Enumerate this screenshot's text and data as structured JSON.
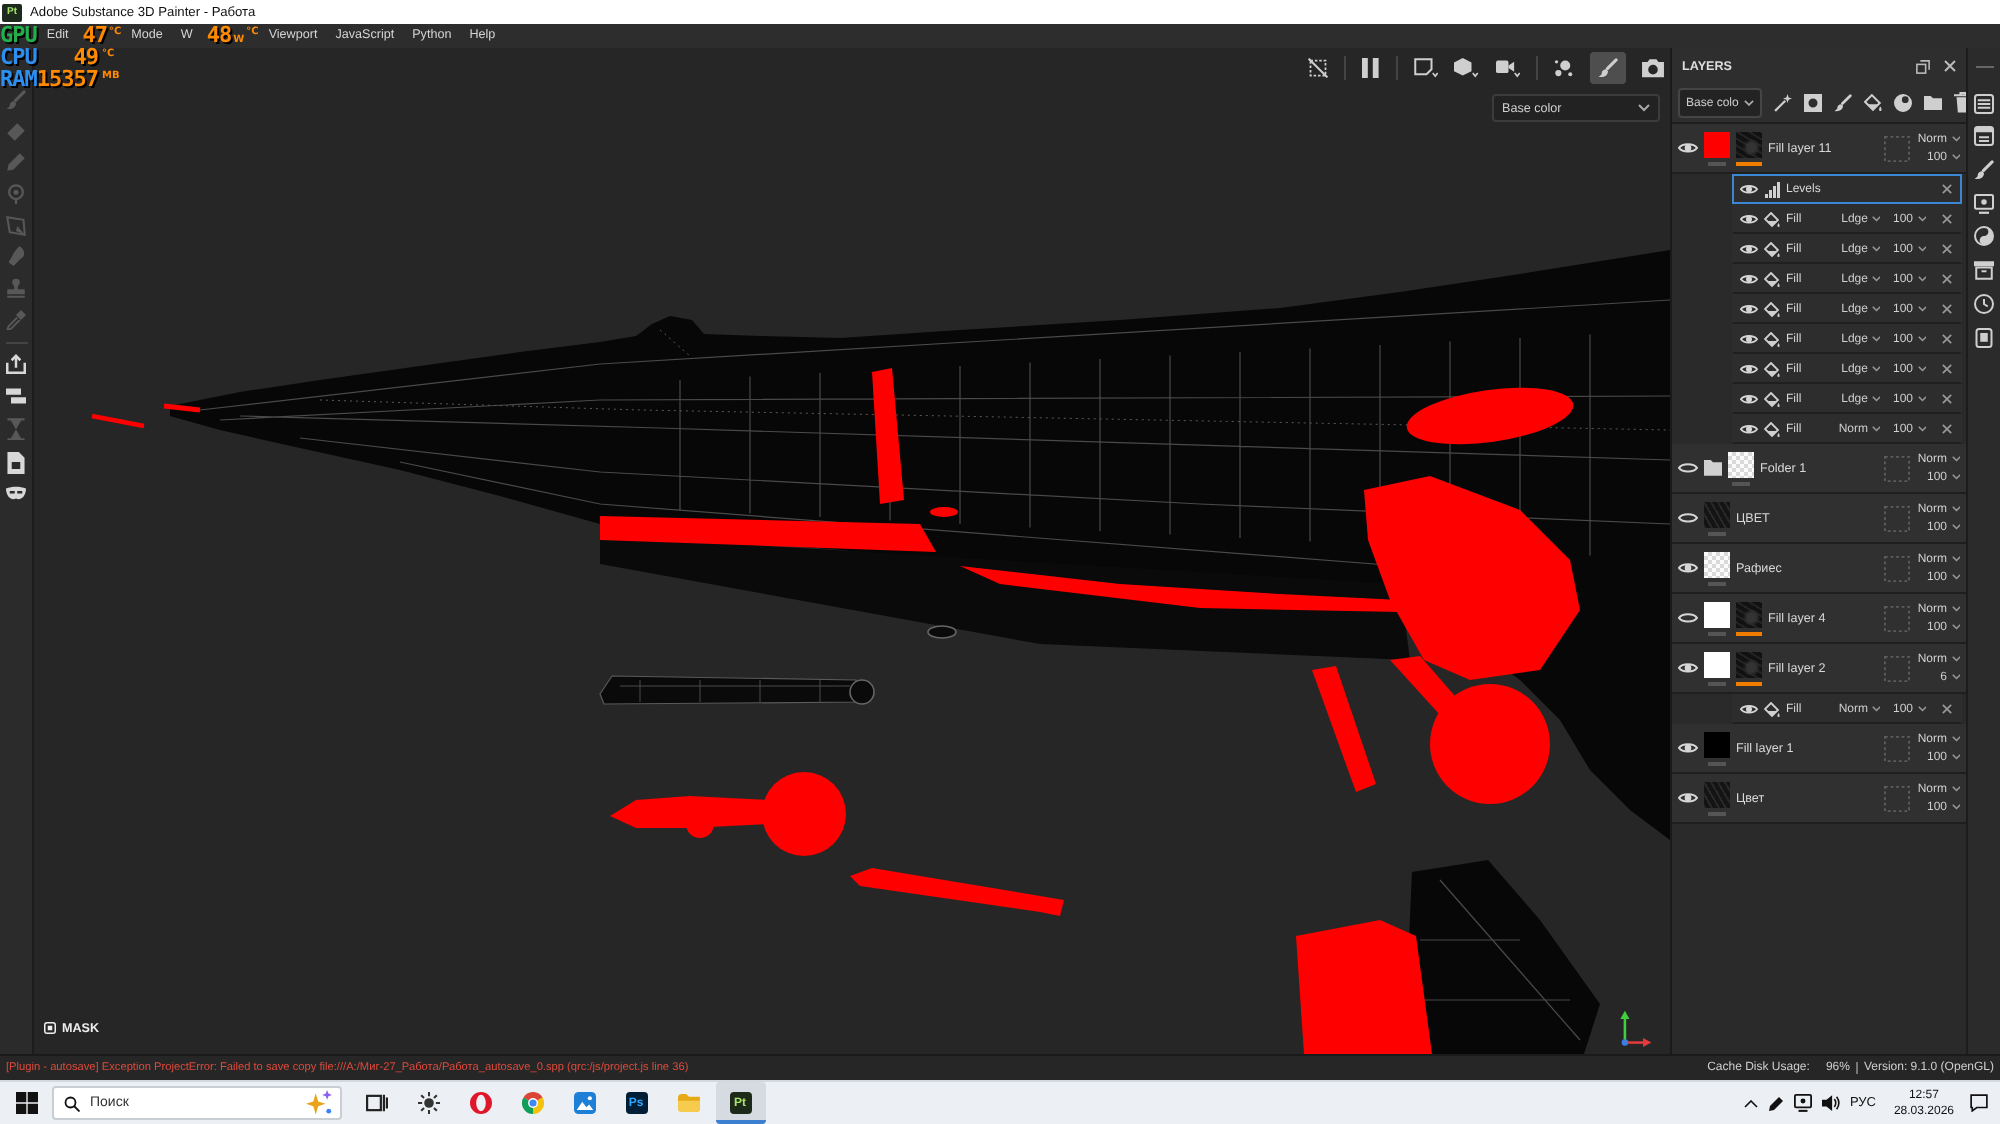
{
  "window": {
    "icon_label": "Pt",
    "title": "Adobe Substance 3D Painter - Работа"
  },
  "menu_bar": [
    {
      "kind": "stat_label",
      "text": "GPU"
    },
    {
      "kind": "menu",
      "text": "Edit"
    },
    {
      "kind": "stat",
      "value": "47",
      "sup": "°C"
    },
    {
      "kind": "menu",
      "text": "Mode"
    },
    {
      "kind": "menu",
      "text": "W"
    },
    {
      "kind": "stat",
      "value": "48",
      "sub": "W",
      "sup": "°C"
    },
    {
      "kind": "menu",
      "text": "Viewport"
    },
    {
      "kind": "menu",
      "text": "JavaScript"
    },
    {
      "kind": "menu",
      "text": "Python"
    },
    {
      "kind": "menu",
      "text": "Help"
    }
  ],
  "stats_overlay": [
    {
      "label": "CPU",
      "value": "49",
      "sup": "°C"
    },
    {
      "label": "RAM",
      "value": "15357",
      "sup": "MB"
    }
  ],
  "tools": [
    {
      "kind": "brush",
      "disabled": true
    },
    {
      "kind": "eraser",
      "disabled": true
    },
    {
      "kind": "projection",
      "disabled": true
    },
    {
      "kind": "geometry",
      "disabled": true
    },
    {
      "kind": "polyfill",
      "disabled": true
    },
    {
      "kind": "smudge",
      "disabled": true
    },
    {
      "kind": "clone",
      "disabled": true
    },
    {
      "kind": "picker",
      "disabled": true
    },
    {
      "kind": "export",
      "disabled": false
    },
    {
      "kind": "bake",
      "disabled": false
    },
    {
      "kind": "hourglass",
      "disabled": true
    },
    {
      "kind": "document",
      "disabled": false
    },
    {
      "kind": "mask",
      "disabled": false
    }
  ],
  "viewport": {
    "tools": [
      {
        "kind": "hide",
        "selected": false
      },
      {
        "kind": "pause",
        "selected": false
      },
      {
        "kind": "frame",
        "selected": false
      },
      {
        "kind": "cube",
        "selected": false
      },
      {
        "kind": "camera",
        "selected": false
      },
      {
        "kind": "paint",
        "selected": false
      },
      {
        "kind": "brush",
        "selected": true
      },
      {
        "kind": "snapshot",
        "selected": false
      }
    ],
    "channel": "Base color",
    "mask_label": "MASK"
  },
  "layers_panel": {
    "title": "LAYERS",
    "channel": "Base colo",
    "layers": [
      {
        "kind": "fill",
        "name": "Fill layer 11",
        "visible": true,
        "selected": false,
        "color": "#ff0000",
        "mask": true,
        "blend": "Norm",
        "opacity": "100",
        "children": [
          {
            "kind": "levels",
            "name": "Levels",
            "visible": true,
            "selected": true
          },
          {
            "kind": "fill",
            "name": "Fill",
            "visible": true,
            "selected": false,
            "blend": "Ldge",
            "opacity": "100"
          },
          {
            "kind": "fill",
            "name": "Fill",
            "visible": true,
            "selected": false,
            "blend": "Ldge",
            "opacity": "100"
          },
          {
            "kind": "fill",
            "name": "Fill",
            "visible": true,
            "selected": false,
            "blend": "Ldge",
            "opacity": "100"
          },
          {
            "kind": "fill",
            "name": "Fill",
            "visible": true,
            "selected": false,
            "blend": "Ldge",
            "opacity": "100"
          },
          {
            "kind": "fill",
            "name": "Fill",
            "visible": true,
            "selected": false,
            "blend": "Ldge",
            "opacity": "100"
          },
          {
            "kind": "fill",
            "name": "Fill",
            "visible": true,
            "selected": false,
            "blend": "Ldge",
            "opacity": "100"
          },
          {
            "kind": "fill",
            "name": "Fill",
            "visible": true,
            "selected": false,
            "blend": "Ldge",
            "opacity": "100"
          },
          {
            "kind": "fill",
            "name": "Fill",
            "visible": true,
            "selected": false,
            "blend": "Norm",
            "opacity": "100"
          }
        ]
      },
      {
        "kind": "folder",
        "name": "Folder 1",
        "visible": false,
        "selected": false,
        "blend": "Norm",
        "opacity": "100"
      },
      {
        "kind": "textured",
        "name": "ЦВЕТ",
        "visible": false,
        "selected": false,
        "blend": "Norm",
        "opacity": "100"
      },
      {
        "kind": "blank",
        "name": "Рафиес",
        "visible": true,
        "selected": false,
        "blend": "Norm",
        "opacity": "100"
      },
      {
        "kind": "fill",
        "name": "Fill layer 4",
        "visible": false,
        "selected": false,
        "color": "#ffffff",
        "mask": true,
        "blend": "Norm",
        "opacity": "100"
      },
      {
        "kind": "fill",
        "name": "Fill layer 2",
        "visible": true,
        "selected": false,
        "color": "#ffffff",
        "mask": true,
        "blend": "Norm",
        "opacity": "6",
        "children": [
          {
            "kind": "fill",
            "name": "Fill",
            "visible": true,
            "selected": false,
            "blend": "Norm",
            "opacity": "100"
          }
        ]
      },
      {
        "kind": "fill",
        "name": "Fill layer 1",
        "visible": true,
        "selected": false,
        "color": "#000000",
        "mask": false,
        "blend": "Norm",
        "opacity": "100"
      },
      {
        "kind": "textured",
        "name": "Цвет",
        "visible": true,
        "selected": false,
        "blend": "Norm",
        "opacity": "100"
      }
    ]
  },
  "status_bar": {
    "message": "[Plugin - autosave] Exception ProjectError: Failed to save copy file:///A:/Миг-27_Работа/Работа_autosave_0.spp (qrc:/js/project.js line 36)",
    "cache_label": "Cache Disk Usage:",
    "cache_value": "96%",
    "version": "Version: 9.1.0 (OpenGL)"
  },
  "taskbar": {
    "search_placeholder": "Поиск",
    "apps": [
      {
        "kind": "taskview",
        "selected": false
      },
      {
        "kind": "widgets",
        "selected": false
      },
      {
        "kind": "opera",
        "selected": false
      },
      {
        "kind": "chrome",
        "selected": false
      },
      {
        "kind": "photos",
        "selected": false
      },
      {
        "kind": "photoshop",
        "label": "Ps",
        "selected": false
      },
      {
        "kind": "explorer",
        "selected": false
      },
      {
        "kind": "painter",
        "label": "Pt",
        "selected": true
      }
    ],
    "language": "РУС",
    "time": "12:57",
    "date": "28.03.2026"
  }
}
